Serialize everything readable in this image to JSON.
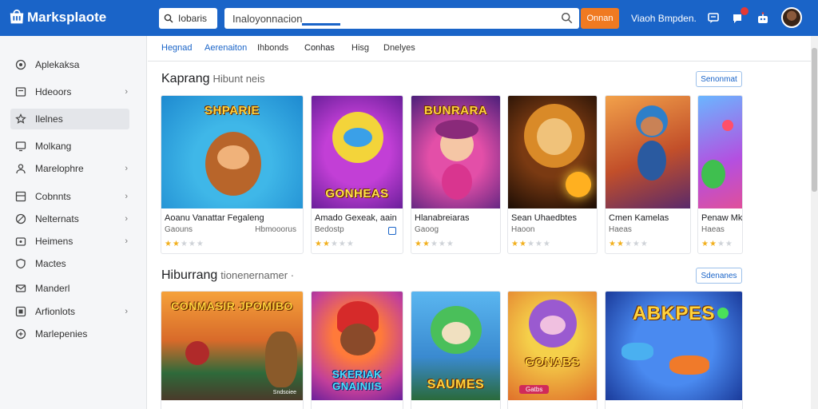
{
  "header": {
    "logo": "Marksplaote",
    "search_small": "Iobaris",
    "search_main": "Inaloyonnacion",
    "search_button": "Onnan",
    "top_link": "Viaoh Bmpden."
  },
  "sidebar": {
    "items": [
      {
        "label": "Aplekaksa",
        "icon": "apps-icon",
        "chev": false
      },
      {
        "label": "Hdeoors",
        "icon": "store-icon",
        "chev": true
      },
      {
        "label": "Ilelnes",
        "icon": "star-icon",
        "chev": false,
        "active": true
      },
      {
        "label": "Molkang",
        "icon": "monitor-icon",
        "chev": false
      },
      {
        "label": "Marelophre",
        "icon": "user-icon",
        "chev": true
      },
      {
        "label": "Cobnnts",
        "icon": "grid-icon",
        "chev": true
      },
      {
        "label": "Nelternats",
        "icon": "globe-icon",
        "chev": true
      },
      {
        "label": "Heimens",
        "icon": "folder-icon",
        "chev": true
      },
      {
        "label": "Mactes",
        "icon": "shield-icon",
        "chev": false
      },
      {
        "label": "Manderl",
        "icon": "mail-icon",
        "chev": false
      },
      {
        "label": "Arfionlots",
        "icon": "box-icon",
        "chev": true
      },
      {
        "label": "Marlepenies",
        "icon": "tag-icon",
        "chev": false
      }
    ]
  },
  "tabs": [
    {
      "label": "Hegnad"
    },
    {
      "label": "Aerenaiton"
    },
    {
      "label": "Ihbonds"
    },
    {
      "label": "Conhas"
    },
    {
      "label": "Hisg"
    },
    {
      "label": "Dnelyes"
    }
  ],
  "sections": [
    {
      "title": "Kaprang",
      "subtitle": "Hibunt neis",
      "see_all": "Senonmat",
      "cards": [
        {
          "art_title": "SHPARIE",
          "title": "Aoanu Vanattar Fegaleng",
          "dev": "Gaouns",
          "dev2": "Hbmooorus",
          "rating": 2
        },
        {
          "art_title": "GONHEAS",
          "title": "Amado Gexeak, aain",
          "dev": "Bedostp",
          "rating": 2
        },
        {
          "art_title": "BUNRARA",
          "title": "Hlanabreiaras",
          "dev": "Gaoog",
          "rating": 2
        },
        {
          "art_title": "",
          "title": "Sean Uhaedbtes",
          "dev": "Haoon",
          "rating": 2
        },
        {
          "art_title": "",
          "title": "Cmen Kamelas",
          "dev": "Haeas",
          "rating": 2
        },
        {
          "art_title": "",
          "title": "Penaw Mk",
          "dev": "Haeas",
          "rating": 2
        }
      ]
    },
    {
      "title": "Hiburrang",
      "subtitle": "tionenernamer ·",
      "see_all": "Sdenanes",
      "cards": [
        {
          "art_title": "CONMASIR JPOMIBO",
          "caption": "Sndsoiee"
        },
        {
          "art_title": "SKERIAK GNAINIIS"
        },
        {
          "art_title": "SAUMES"
        },
        {
          "art_title": "GONABS",
          "caption": "Gatbs"
        },
        {
          "art_title": "ABKPES"
        }
      ]
    }
  ],
  "colors": {
    "accent": "#1a64c8",
    "search_button": "#f07a22",
    "star": "#f2b01e"
  }
}
